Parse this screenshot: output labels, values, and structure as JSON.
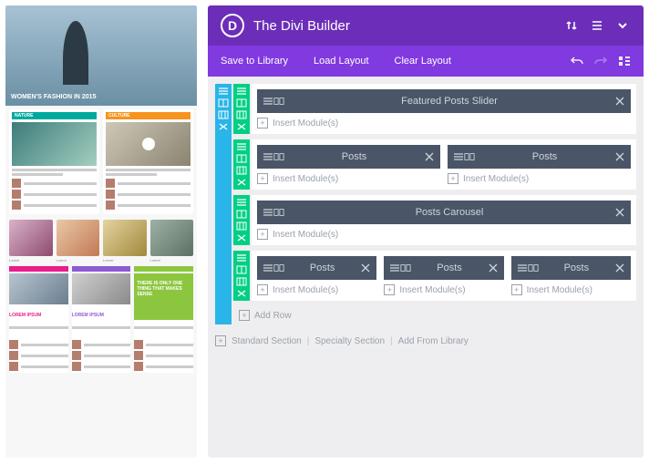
{
  "header": {
    "title": "The Divi Builder",
    "logo_letter": "D"
  },
  "subnav": {
    "save": "Save to Library",
    "load": "Load Layout",
    "clear": "Clear Layout"
  },
  "sections": [
    {
      "rows": [
        {
          "cols": [
            {
              "modules": [
                {
                  "label": "Featured Posts Slider"
                }
              ],
              "insert": "Insert Module(s)"
            }
          ]
        },
        {
          "cols": [
            {
              "modules": [
                {
                  "label": "Posts"
                }
              ],
              "insert": "Insert Module(s)"
            },
            {
              "modules": [
                {
                  "label": "Posts"
                }
              ],
              "insert": "Insert Module(s)"
            }
          ]
        },
        {
          "cols": [
            {
              "modules": [
                {
                  "label": "Posts Carousel"
                }
              ],
              "insert": "Insert Module(s)"
            }
          ]
        },
        {
          "cols": [
            {
              "modules": [
                {
                  "label": "Posts"
                }
              ],
              "insert": "Insert Module(s)"
            },
            {
              "modules": [
                {
                  "label": "Posts"
                }
              ],
              "insert": "Insert Module(s)"
            },
            {
              "modules": [
                {
                  "label": "Posts"
                }
              ],
              "insert": "Insert Module(s)"
            }
          ]
        }
      ],
      "addrow": "Add Row"
    }
  ],
  "footer": {
    "standard": "Standard Section",
    "specialty": "Specialty Section",
    "library": "Add From Library"
  },
  "preview": {
    "hero": "WOMEN'S FASHION IN 2015",
    "tag1": "NATURE",
    "tag2": "CULTURE"
  }
}
